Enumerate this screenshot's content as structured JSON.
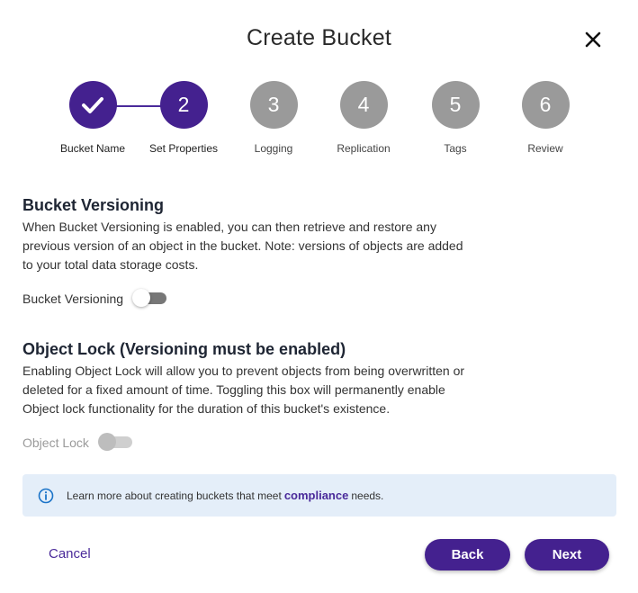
{
  "dialog": {
    "title": "Create Bucket"
  },
  "steps": [
    {
      "number": "",
      "label": "Bucket Name",
      "state": "completed"
    },
    {
      "number": "2",
      "label": "Set Properties",
      "state": "active"
    },
    {
      "number": "3",
      "label": "Logging",
      "state": "inactive"
    },
    {
      "number": "4",
      "label": "Replication",
      "state": "inactive"
    },
    {
      "number": "5",
      "label": "Tags",
      "state": "inactive"
    },
    {
      "number": "6",
      "label": "Review",
      "state": "inactive"
    }
  ],
  "versioning": {
    "title": "Bucket Versioning",
    "description": "When Bucket Versioning is enabled, you can then retrieve and restore any previous version of an object in the bucket. Note: versions of objects are added to your total data storage costs.",
    "toggle_label": "Bucket Versioning",
    "enabled": false
  },
  "object_lock": {
    "title": "Object Lock (Versioning must be enabled)",
    "description": "Enabling Object Lock will allow you to prevent objects from being overwritten or deleted for a fixed amount of time. Toggling this box will permanently enable Object lock functionality for the duration of this bucket's existence.",
    "toggle_label": "Object Lock",
    "enabled": false,
    "disabled": true
  },
  "info": {
    "prefix": "Learn more about creating buckets that meet",
    "link": "compliance",
    "suffix": "needs."
  },
  "footer": {
    "cancel_label": "Cancel",
    "back_label": "Back",
    "next_label": "Next"
  },
  "colors": {
    "accent": "#44218f",
    "inactive_step": "#9a9a9a",
    "info_bg": "#e4eef9"
  },
  "icons": {
    "close": "close-icon",
    "check": "check-icon",
    "info": "info-icon"
  }
}
